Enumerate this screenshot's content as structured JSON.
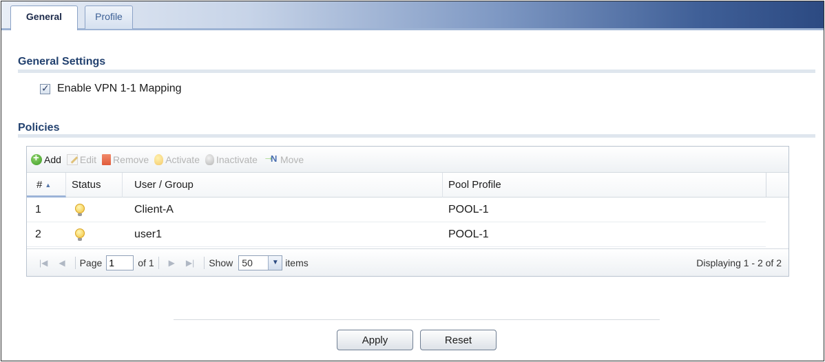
{
  "tabs": [
    {
      "label": "General",
      "active": true
    },
    {
      "label": "Profile",
      "active": false
    }
  ],
  "general_settings": {
    "title": "General Settings",
    "checkbox_label": "Enable VPN 1-1 Mapping",
    "checked": true
  },
  "policies": {
    "title": "Policies",
    "toolbar": {
      "add": "Add",
      "edit": "Edit",
      "remove": "Remove",
      "activate": "Activate",
      "inactivate": "Inactivate",
      "move": "Move"
    },
    "columns": {
      "num": "#",
      "status": "Status",
      "user_group": "User / Group",
      "pool_profile": "Pool Profile"
    },
    "rows": [
      {
        "num": "1",
        "status_icon": "lightbulb-on-icon",
        "user_group": "Client-A",
        "pool_profile": "POOL-1"
      },
      {
        "num": "2",
        "status_icon": "lightbulb-on-icon",
        "user_group": "user1",
        "pool_profile": "POOL-1"
      }
    ],
    "pager": {
      "page_label": "Page",
      "page_value": "1",
      "of_label": "of 1",
      "show_label": "Show",
      "show_value": "50",
      "items_label": "items",
      "display_text": "Displaying 1 - 2 of 2"
    }
  },
  "buttons": {
    "apply": "Apply",
    "reset": "Reset"
  }
}
